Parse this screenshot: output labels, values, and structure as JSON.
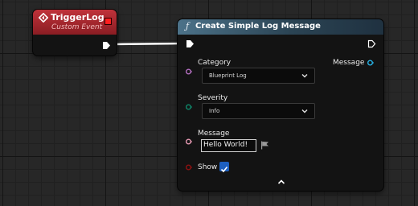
{
  "event_node": {
    "title": "TriggerLog",
    "subtitle": "Custom Event",
    "colors": {
      "header": "#b0262e",
      "delegate_pin": "#ff1f1f"
    }
  },
  "function_node": {
    "title": "Create Simple Log Message",
    "icon": "function-icon",
    "inputs": {
      "category": {
        "label": "Category",
        "value": "Blueprint Log"
      },
      "severity": {
        "label": "Severity",
        "value": "Info"
      },
      "message": {
        "label": "Message",
        "value": "Hello World!"
      },
      "show": {
        "label": "Show",
        "checked": true
      }
    },
    "outputs": {
      "message": {
        "label": "Message"
      }
    },
    "colors": {
      "header": "#3f5f74",
      "category_pin": "#b46fc0",
      "severity_pin": "#0f8a6c",
      "message_in_pin": "#e79ab3",
      "show_pin": "#8f1111",
      "message_out_pin": "#27b3e6",
      "checkbox": "#1d5fbf"
    }
  }
}
